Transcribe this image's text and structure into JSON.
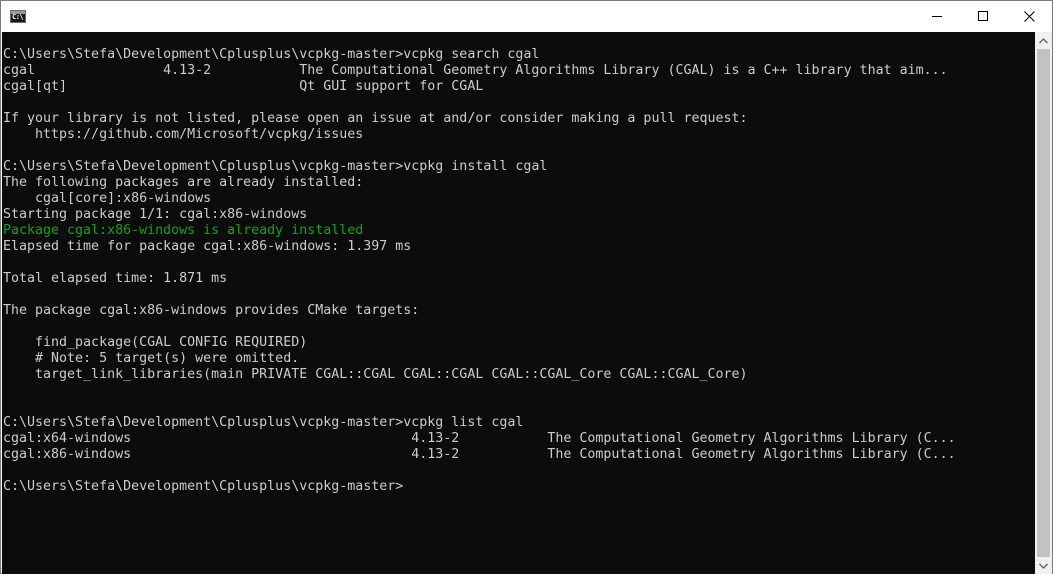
{
  "window": {
    "title": "",
    "icon": "console-icon",
    "controls": {
      "minimize": "minimize-icon",
      "maximize": "maximize-icon",
      "close": "close-icon"
    }
  },
  "console": {
    "background": "#0c0c0c",
    "foreground": "#cccccc",
    "success_color": "#13a10e",
    "lines": [
      {
        "text": "C:\\Users\\Stefa\\Development\\Cplusplus\\vcpkg-master>vcpkg search cgal",
        "style": "normal"
      },
      {
        "text": "cgal                4.13-2           The Computational Geometry Algorithms Library (CGAL) is a C++ library that aim...",
        "style": "normal"
      },
      {
        "text": "cgal[qt]                             Qt GUI support for CGAL",
        "style": "normal"
      },
      {
        "text": "",
        "style": "normal"
      },
      {
        "text": "If your library is not listed, please open an issue at and/or consider making a pull request:",
        "style": "normal"
      },
      {
        "text": "    https://github.com/Microsoft/vcpkg/issues",
        "style": "normal"
      },
      {
        "text": "",
        "style": "normal"
      },
      {
        "text": "C:\\Users\\Stefa\\Development\\Cplusplus\\vcpkg-master>vcpkg install cgal",
        "style": "normal"
      },
      {
        "text": "The following packages are already installed:",
        "style": "normal"
      },
      {
        "text": "    cgal[core]:x86-windows",
        "style": "normal"
      },
      {
        "text": "Starting package 1/1: cgal:x86-windows",
        "style": "normal"
      },
      {
        "text": "Package cgal:x86-windows is already installed",
        "style": "green"
      },
      {
        "text": "Elapsed time for package cgal:x86-windows: 1.397 ms",
        "style": "normal"
      },
      {
        "text": "",
        "style": "normal"
      },
      {
        "text": "Total elapsed time: 1.871 ms",
        "style": "normal"
      },
      {
        "text": "",
        "style": "normal"
      },
      {
        "text": "The package cgal:x86-windows provides CMake targets:",
        "style": "normal"
      },
      {
        "text": "",
        "style": "normal"
      },
      {
        "text": "    find_package(CGAL CONFIG REQUIRED)",
        "style": "normal"
      },
      {
        "text": "    # Note: 5 target(s) were omitted.",
        "style": "normal"
      },
      {
        "text": "    target_link_libraries(main PRIVATE CGAL::CGAL CGAL::CGAL CGAL::CGAL_Core CGAL::CGAL_Core)",
        "style": "normal"
      },
      {
        "text": "",
        "style": "normal"
      },
      {
        "text": "",
        "style": "normal"
      },
      {
        "text": "C:\\Users\\Stefa\\Development\\Cplusplus\\vcpkg-master>vcpkg list cgal",
        "style": "normal"
      },
      {
        "text": "cgal:x64-windows                                   4.13-2           The Computational Geometry Algorithms Library (C...",
        "style": "normal"
      },
      {
        "text": "cgal:x86-windows                                   4.13-2           The Computational Geometry Algorithms Library (C...",
        "style": "normal"
      },
      {
        "text": "",
        "style": "normal"
      },
      {
        "text": "C:\\Users\\Stefa\\Development\\Cplusplus\\vcpkg-master>",
        "style": "normal"
      }
    ]
  },
  "scrollbar": {
    "up_icon": "scroll-up-arrow-icon",
    "down_icon": "scroll-down-arrow-icon",
    "position": 1.0
  }
}
